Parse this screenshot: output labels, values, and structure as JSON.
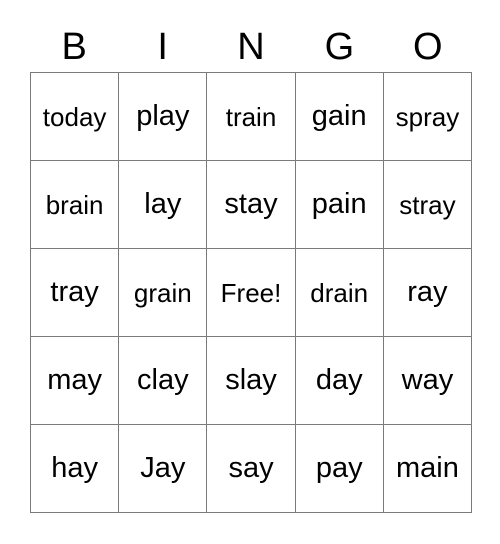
{
  "card": {
    "title": "BINGO",
    "header_letters": [
      "B",
      "I",
      "N",
      "G",
      "O"
    ],
    "free_space_label": "Free!",
    "colors": {
      "background": "#ffffff",
      "text": "#000000",
      "grid_line": "#7a7a7a"
    },
    "grid": {
      "columns": 5,
      "rows": 5,
      "cells": [
        [
          "today",
          "play",
          "train",
          "gain",
          "spray"
        ],
        [
          "brain",
          "lay",
          "stay",
          "pain",
          "stray"
        ],
        [
          "tray",
          "grain",
          "Free!",
          "drain",
          "ray"
        ],
        [
          "may",
          "clay",
          "slay",
          "day",
          "way"
        ],
        [
          "hay",
          "Jay",
          "say",
          "pay",
          "main"
        ]
      ]
    }
  }
}
